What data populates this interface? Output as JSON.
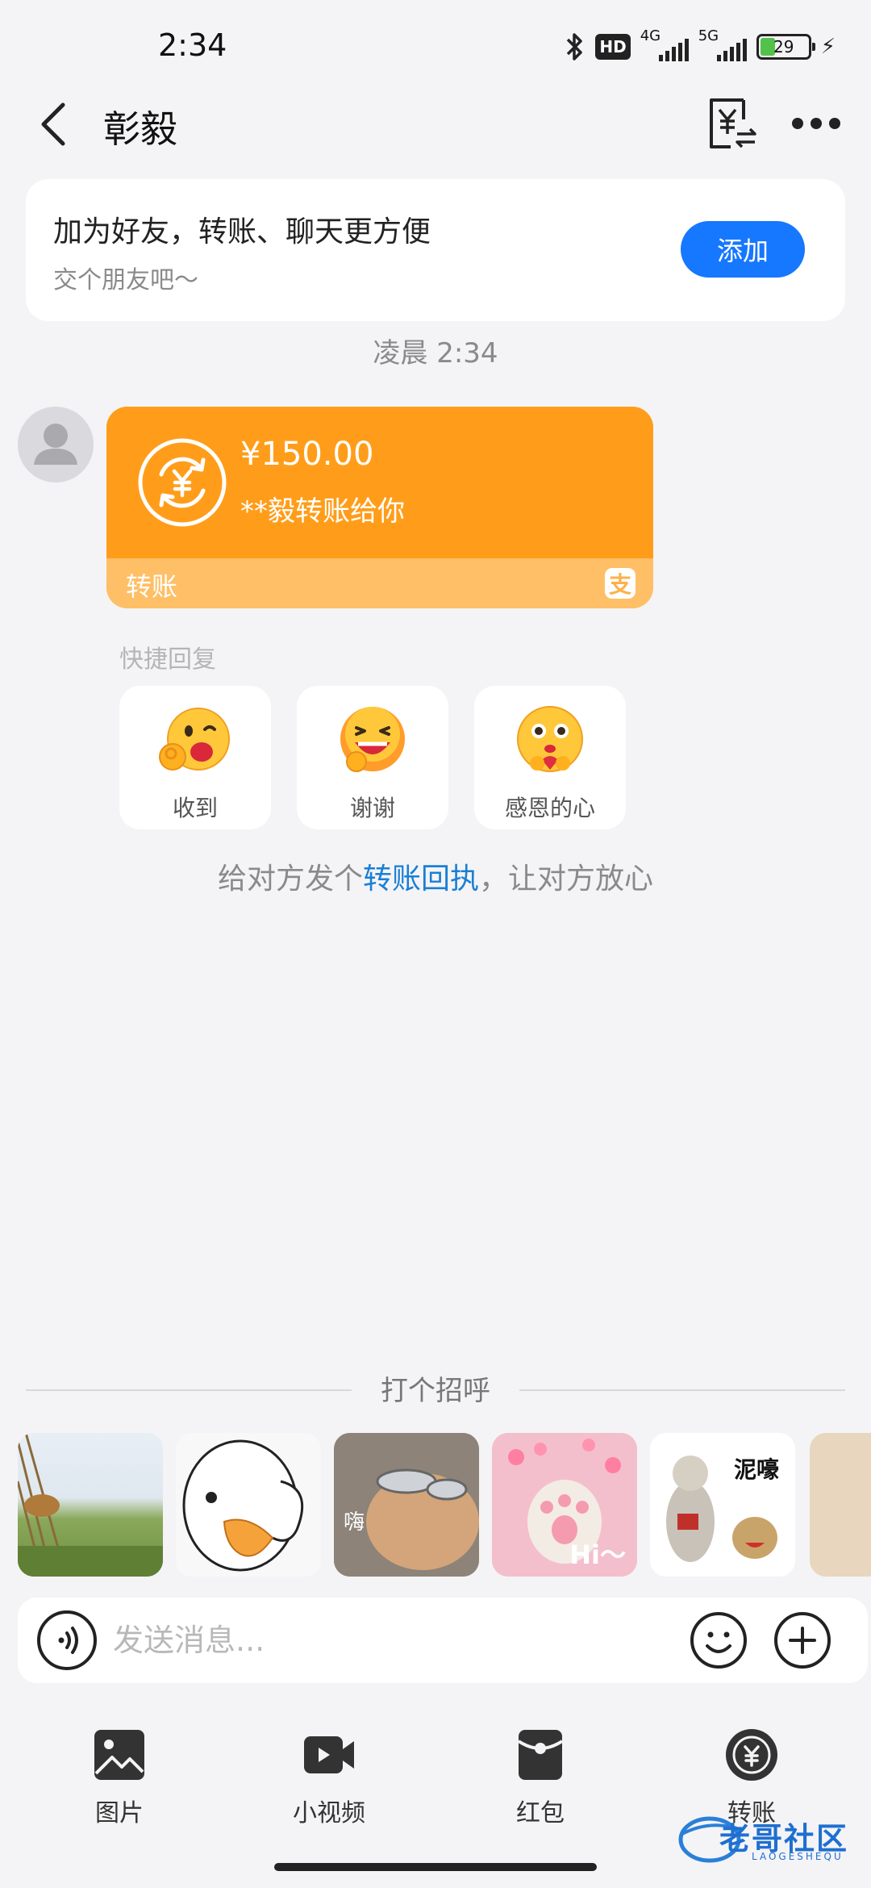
{
  "status_bar": {
    "time": "2:34",
    "hd_badge": "HD",
    "net1_label": "4G",
    "net2_label": "5G",
    "battery_level": "29",
    "battery_fraction": 0.29
  },
  "header": {
    "title": "彰毅"
  },
  "add_friend": {
    "title": "加为好友，转账、聊天更方便",
    "subtitle": "交个朋友吧～",
    "button": "添加"
  },
  "timestamp": "凌晨 2:34",
  "transfer": {
    "amount": "¥150.00",
    "description": "**毅转账给你",
    "label": "转账",
    "brand_icon": "支"
  },
  "quick_reply": {
    "label": "快捷回复",
    "items": [
      {
        "label": "收到",
        "icon": "ok-hand-emoji-icon"
      },
      {
        "label": "谢谢",
        "icon": "grinning-thanks-emoji-icon"
      },
      {
        "label": "感恩的心",
        "icon": "heart-hands-emoji-icon"
      }
    ]
  },
  "receipt_tip": {
    "prefix": "给对方发个",
    "link": "转账回执",
    "suffix": "，让对方放心"
  },
  "greeting": {
    "label": "打个招呼",
    "stickers": [
      {
        "caption": "",
        "icon": "field-sticker"
      },
      {
        "caption": "",
        "icon": "duck-sticker"
      },
      {
        "caption": "嗨",
        "icon": "sunglasses-cat-sticker"
      },
      {
        "caption": "Hi～",
        "icon": "cat-paw-sticker"
      },
      {
        "caption": "泥嚎",
        "icon": "waving-cat-dog-sticker"
      }
    ]
  },
  "input": {
    "placeholder": "发送消息..."
  },
  "tools": [
    {
      "label": "图片",
      "icon": "image-icon"
    },
    {
      "label": "小视频",
      "icon": "video-icon"
    },
    {
      "label": "红包",
      "icon": "red-packet-icon"
    },
    {
      "label": "转账",
      "icon": "transfer-yuan-icon"
    }
  ],
  "watermark": {
    "text": "老哥社区",
    "sub": "LAOGESHEQU"
  },
  "colors": {
    "accent_blue": "#1677ff",
    "transfer_orange": "#ff9d1a",
    "transfer_light": "#ffbf66",
    "link_blue": "#1a7fd4",
    "background": "#f4f4f6"
  }
}
